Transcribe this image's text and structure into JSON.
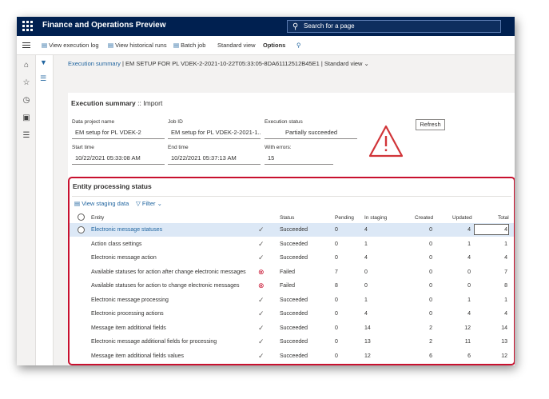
{
  "app": {
    "title": "Finance and Operations Preview",
    "search_placeholder": "Search for a page"
  },
  "actions": {
    "view_execution_log": "View execution log",
    "view_historical_runs": "View historical runs",
    "batch_job": "Batch job",
    "standard_view": "Standard view",
    "options": "Options"
  },
  "breadcrumb": {
    "link": "Execution summary",
    "sep1": "|",
    "job": "EM SETUP FOR PL VDEK-2-2021-10-22T05:33:05-8DA61112512B45E1",
    "sep2": "|",
    "view": "Standard view"
  },
  "summary": {
    "title_prefix": "Execution summary",
    "title_sep": "::",
    "title_suffix": "Import",
    "data_project_label": "Data project name",
    "data_project_value": "EM setup for PL VDEK-2",
    "job_id_label": "Job ID",
    "job_id_value": "EM setup for PL VDEK-2-2021-1...",
    "exec_status_label": "Execution status",
    "exec_status_value": "Partially succeeded",
    "start_time_label": "Start time",
    "start_time_value": "10/22/2021 05:33:08 AM",
    "end_time_label": "End time",
    "end_time_value": "10/22/2021 05:37:13 AM",
    "with_errors_label": "With errors:",
    "with_errors_value": "15",
    "refresh_label": "Refresh"
  },
  "entity_grid": {
    "title": "Entity processing status",
    "view_staging": "View staging data",
    "filter": "Filter",
    "columns": {
      "entity": "Entity",
      "status": "Status",
      "pending": "Pending",
      "in_staging": "In staging",
      "created": "Created",
      "updated": "Updated",
      "total": "Total"
    },
    "rows": [
      {
        "entity": "Electronic message statuses",
        "status": "Succeeded",
        "pending": "0",
        "in_staging": "4",
        "created": "0",
        "updated": "4",
        "total": "4",
        "failed": false
      },
      {
        "entity": "Action class settings",
        "status": "Succeeded",
        "pending": "0",
        "in_staging": "1",
        "created": "0",
        "updated": "1",
        "total": "1",
        "failed": false
      },
      {
        "entity": "Electronic message action",
        "status": "Succeeded",
        "pending": "0",
        "in_staging": "4",
        "created": "0",
        "updated": "4",
        "total": "4",
        "failed": false
      },
      {
        "entity": "Available statuses for action after change electronic messages",
        "status": "Failed",
        "pending": "7",
        "in_staging": "0",
        "created": "0",
        "updated": "0",
        "total": "7",
        "failed": true
      },
      {
        "entity": "Available statuses for action to change electronic messages",
        "status": "Failed",
        "pending": "8",
        "in_staging": "0",
        "created": "0",
        "updated": "0",
        "total": "8",
        "failed": true
      },
      {
        "entity": "Electronic message processing",
        "status": "Succeeded",
        "pending": "0",
        "in_staging": "1",
        "created": "0",
        "updated": "1",
        "total": "1",
        "failed": false
      },
      {
        "entity": "Electronic processing actions",
        "status": "Succeeded",
        "pending": "0",
        "in_staging": "4",
        "created": "0",
        "updated": "4",
        "total": "4",
        "failed": false
      },
      {
        "entity": "Message item additional fields",
        "status": "Succeeded",
        "pending": "0",
        "in_staging": "14",
        "created": "2",
        "updated": "12",
        "total": "14",
        "failed": false
      },
      {
        "entity": "Electronic message additional fields for processing",
        "status": "Succeeded",
        "pending": "0",
        "in_staging": "13",
        "created": "2",
        "updated": "11",
        "total": "13",
        "failed": false
      },
      {
        "entity": "Message item additional fields values",
        "status": "Succeeded",
        "pending": "0",
        "in_staging": "12",
        "created": "6",
        "updated": "6",
        "total": "12",
        "failed": false
      }
    ]
  },
  "colors": {
    "topbar": "#002050",
    "accent": "#2266a0",
    "error": "#c8102e",
    "selected_row": "#dce8f6"
  }
}
